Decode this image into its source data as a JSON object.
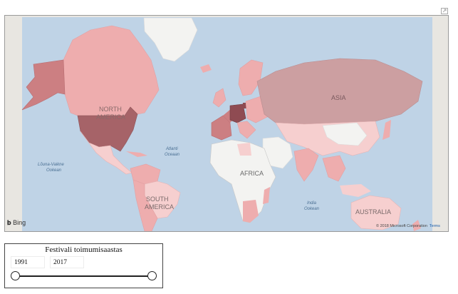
{
  "map": {
    "continent_labels": [
      "NORTH",
      "AMERICA",
      "SOUTH",
      "AMERICA",
      "AFRICA",
      "ASIA",
      "AUSTRALIA"
    ],
    "ocean_labels": [
      "Atlanti",
      "Oceaan",
      "Lõuna-Vaikne",
      "Ookean",
      "India",
      "Ookean"
    ],
    "provider": "Bing",
    "copyright": "© 2018 Microsoft Corporation",
    "terms_label": "Terms",
    "colors": {
      "ocean": "#bfd3e6",
      "land": "#f3f3f1",
      "shade_light": "#f6cfcf",
      "shade_mid": "#eeadae",
      "shade_dark": "#cc7f82",
      "shade_max": "#8f4b52"
    }
  },
  "slicer": {
    "title": "Festivali toimumisaastas",
    "from_value": "1991",
    "to_value": "2017"
  }
}
